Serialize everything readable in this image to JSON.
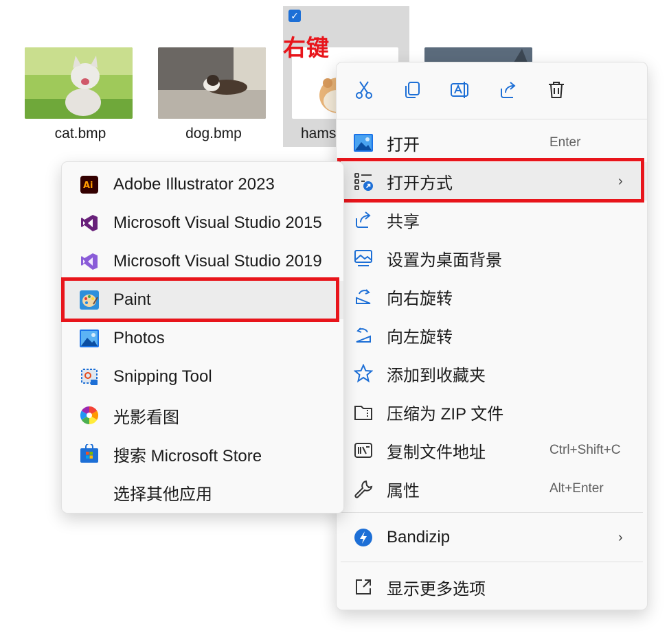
{
  "files": [
    {
      "name": "cat.bmp"
    },
    {
      "name": "dog.bmp"
    },
    {
      "name": "hams",
      "selected": true
    }
  ],
  "annotation": "右键",
  "toolbar": {
    "cut": "cut-icon",
    "copy": "copy-icon",
    "rename": "rename-icon",
    "share": "share-icon",
    "delete": "delete-icon"
  },
  "context_menu": {
    "items": [
      {
        "label": "打开",
        "shortcut": "Enter",
        "icon": "image-icon"
      },
      {
        "label": "打开方式",
        "icon": "open-with-icon",
        "submenu": true,
        "highlighted": true
      },
      {
        "label": "共享",
        "icon": "share-icon"
      },
      {
        "label": "设置为桌面背景",
        "icon": "desktop-background-icon"
      },
      {
        "label": "向右旋转",
        "icon": "rotate-right-icon"
      },
      {
        "label": "向左旋转",
        "icon": "rotate-left-icon"
      },
      {
        "label": "添加到收藏夹",
        "icon": "star-icon"
      },
      {
        "label": "压缩为 ZIP 文件",
        "icon": "zip-icon"
      },
      {
        "label": "复制文件地址",
        "shortcut": "Ctrl+Shift+C",
        "icon": "copy-path-icon"
      },
      {
        "label": "属性",
        "shortcut": "Alt+Enter",
        "icon": "wrench-icon"
      },
      {
        "label": "Bandizip",
        "icon": "bandizip-icon",
        "submenu": true
      },
      {
        "label": "显示更多选项",
        "icon": "show-more-icon"
      }
    ]
  },
  "open_with_menu": {
    "items": [
      {
        "label": "Adobe Illustrator 2023",
        "icon": "illustrator-icon"
      },
      {
        "label": "Microsoft Visual Studio 2015",
        "icon": "visual-studio-icon"
      },
      {
        "label": "Microsoft Visual Studio 2019",
        "icon": "visual-studio-icon"
      },
      {
        "label": "Paint",
        "icon": "paint-icon",
        "highlighted": true
      },
      {
        "label": "Photos",
        "icon": "photos-icon"
      },
      {
        "label": "Snipping Tool",
        "icon": "snipping-tool-icon"
      },
      {
        "label": "光影看图",
        "icon": "color-wheel-icon"
      },
      {
        "label": "搜索 Microsoft Store",
        "icon": "store-icon"
      },
      {
        "label": "选择其他应用"
      }
    ]
  },
  "colors": {
    "highlight_box": "#e8151b",
    "accent": "#1d6fd6",
    "menu_bg": "#f9f9f9"
  }
}
